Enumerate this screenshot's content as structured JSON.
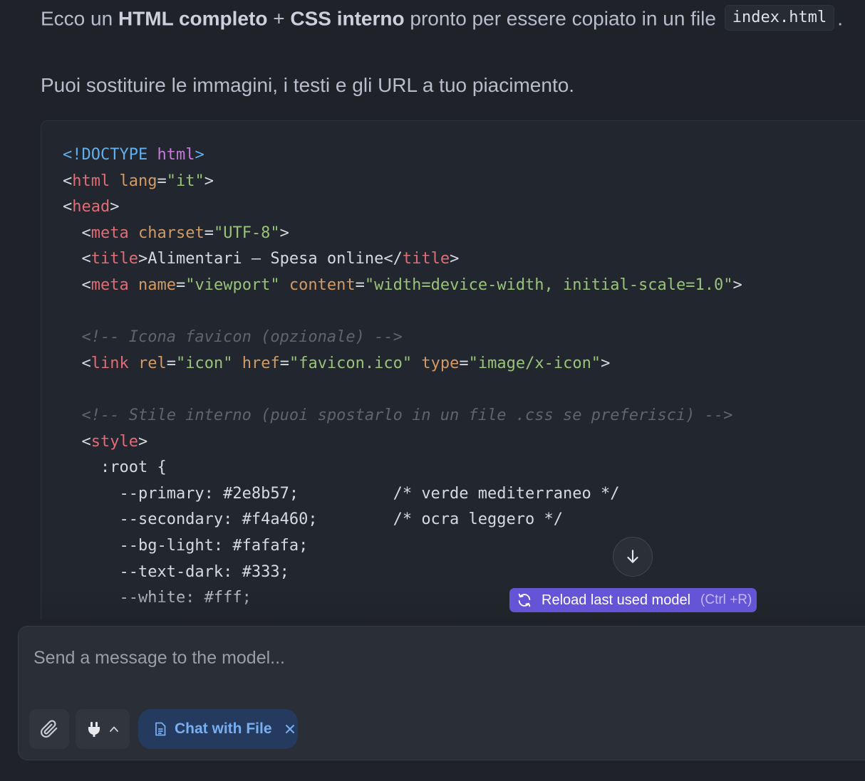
{
  "message": {
    "para1": {
      "t1": "Ecco un ",
      "b1": "HTML completo",
      "t2": " + ",
      "b2": "CSS interno",
      "t3": " pronto per essere copiato in un file ",
      "code": "index.html",
      "t4": "."
    },
    "para2": "Puoi sostituire le immagini, i testi e gli URL a tuo piacimento."
  },
  "code_block": {
    "language": "html",
    "lines": [
      [
        [
          "c-blue",
          "<!DOCTYPE "
        ],
        [
          "c-purple",
          "html"
        ],
        [
          "c-blue",
          ">"
        ]
      ],
      [
        [
          "",
          "<"
        ],
        [
          "c-red",
          "html"
        ],
        [
          "",
          "",
          " "
        ],
        [
          "c-orange",
          "lang"
        ],
        [
          "",
          "="
        ],
        [
          "c-green",
          "\"it\""
        ],
        [
          "",
          ">"
        ]
      ],
      [
        [
          "",
          "<"
        ],
        [
          "c-red",
          "head"
        ],
        [
          "",
          ">"
        ]
      ],
      [
        [
          "",
          "  <"
        ],
        [
          "c-red",
          "meta"
        ],
        [
          "",
          "",
          " "
        ],
        [
          "c-orange",
          "charset"
        ],
        [
          "",
          "="
        ],
        [
          "c-green",
          "\"UTF-8\""
        ],
        [
          "",
          ">"
        ]
      ],
      [
        [
          "",
          "  <"
        ],
        [
          "c-red",
          "title"
        ],
        [
          "",
          ">Alimentari – Spesa online</"
        ],
        [
          "c-red",
          "title"
        ],
        [
          "",
          ">"
        ]
      ],
      [
        [
          "",
          "  <"
        ],
        [
          "c-red",
          "meta"
        ],
        [
          "",
          "",
          " "
        ],
        [
          "c-orange",
          "name"
        ],
        [
          "",
          "="
        ],
        [
          "c-green",
          "\"viewport\""
        ],
        [
          "",
          "",
          " "
        ],
        [
          "c-orange",
          "content"
        ],
        [
          "",
          "="
        ],
        [
          "c-green",
          "\"width=device-width, initial-scale=1.0\""
        ],
        [
          "",
          ">"
        ]
      ],
      [],
      [
        [
          "c-cmt",
          "  <!-- Icona favicon (opzionale) -->"
        ]
      ],
      [
        [
          "",
          "  <"
        ],
        [
          "c-red",
          "link"
        ],
        [
          "",
          "",
          " "
        ],
        [
          "c-orange",
          "rel"
        ],
        [
          "",
          "="
        ],
        [
          "c-green",
          "\"icon\""
        ],
        [
          "",
          "",
          " "
        ],
        [
          "c-orange",
          "href"
        ],
        [
          "",
          "="
        ],
        [
          "c-green",
          "\"favicon.ico\""
        ],
        [
          "",
          "",
          " "
        ],
        [
          "c-orange",
          "type"
        ],
        [
          "",
          "="
        ],
        [
          "c-green",
          "\"image/x-icon\""
        ],
        [
          "",
          ">"
        ]
      ],
      [],
      [
        [
          "c-cmt",
          "  <!-- Stile interno (puoi spostarlo in un file .css se preferisci) -->"
        ]
      ],
      [
        [
          "",
          "  <"
        ],
        [
          "c-red",
          "style"
        ],
        [
          "",
          ">"
        ]
      ],
      [
        [
          "",
          "    :root {"
        ]
      ],
      [
        [
          "",
          "      --primary: #2e8b57;          /* verde mediterraneo */"
        ]
      ],
      [
        [
          "",
          "      --secondary: #f4a460;        /* ocra leggero */"
        ]
      ],
      [
        [
          "",
          "      --bg-light: #fafafa;"
        ]
      ],
      [
        [
          "",
          "      --text-dark: #333;"
        ]
      ],
      [
        [
          "",
          "      --white: #fff;"
        ]
      ]
    ]
  },
  "reload": {
    "label": "Reload last used model",
    "shortcut": "(Ctrl +R)"
  },
  "input": {
    "placeholder": "Send a message to the model..."
  },
  "chip": {
    "label": "Chat with File"
  },
  "icons": {
    "scroll": "arrow-down-icon",
    "reload": "refresh-icon",
    "attach": "paperclip-icon",
    "plug": "plug-icon",
    "chevron": "chevron-up-icon",
    "file": "document-icon",
    "close": "close-icon"
  },
  "colors": {
    "background": "#1f2228",
    "accent": "#6654d6",
    "chip": "#243a5e",
    "chip_text": "#78aef2"
  }
}
